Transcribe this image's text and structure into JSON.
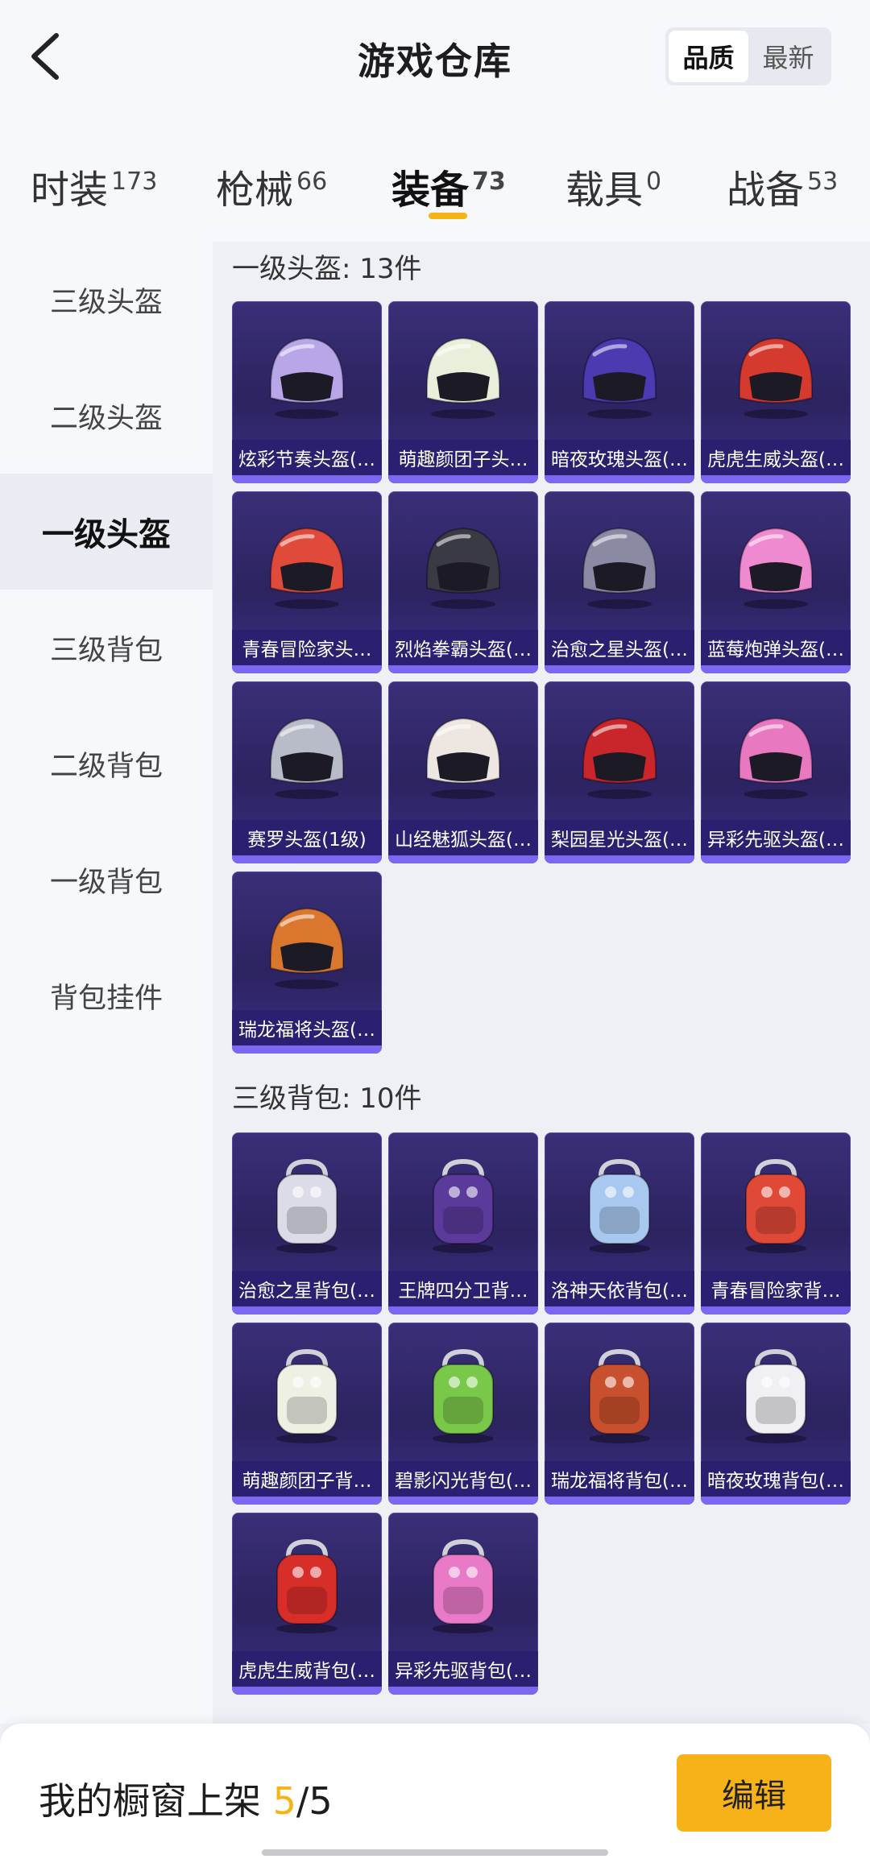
{
  "header": {
    "title": "游戏仓库",
    "sort_options": [
      "品质",
      "最新"
    ],
    "active_sort": "品质"
  },
  "tabs": [
    {
      "label": "时装",
      "count": "173"
    },
    {
      "label": "枪械",
      "count": "66"
    },
    {
      "label": "装备",
      "count": "73"
    },
    {
      "label": "载具",
      "count": "0"
    },
    {
      "label": "战备",
      "count": "53"
    }
  ],
  "active_tab": "装备",
  "sidebar": {
    "items": [
      "三级头盔",
      "二级头盔",
      "一级头盔",
      "三级背包",
      "二级背包",
      "一级背包",
      "背包挂件"
    ],
    "active": "一级头盔"
  },
  "sections": [
    {
      "title": "一级头盔: 13件",
      "items": [
        {
          "name": "炫彩节奏头盔(…",
          "icon": "helmet-icon",
          "color": "#b9a6e8"
        },
        {
          "name": "萌趣颜团子头…",
          "icon": "helmet-icon",
          "color": "#e8f0dc"
        },
        {
          "name": "暗夜玫瑰头盔(…",
          "icon": "helmet-icon",
          "color": "#4b3ab0"
        },
        {
          "name": "虎虎生威头盔(…",
          "icon": "helmet-icon",
          "color": "#d63a2e"
        },
        {
          "name": "青春冒险家头…",
          "icon": "helmet-icon",
          "color": "#e04a3a"
        },
        {
          "name": "烈焰拳霸头盔(…",
          "icon": "helmet-icon",
          "color": "#3a3a44"
        },
        {
          "name": "治愈之星头盔(…",
          "icon": "helmet-icon",
          "color": "#8a8aa4"
        },
        {
          "name": "蓝莓炮弹头盔(…",
          "icon": "helmet-icon",
          "color": "#f08ad0"
        },
        {
          "name": "赛罗头盔(1级)",
          "icon": "helmet-icon",
          "color": "#b8bcc8"
        },
        {
          "name": "山经魅狐头盔(…",
          "icon": "helmet-icon",
          "color": "#eee6e0"
        },
        {
          "name": "梨园星光头盔(…",
          "icon": "helmet-icon",
          "color": "#c8262a"
        },
        {
          "name": "异彩先驱头盔(…",
          "icon": "helmet-icon",
          "color": "#e878c0"
        },
        {
          "name": "瑞龙福将头盔(…",
          "icon": "helmet-icon",
          "color": "#d9772e"
        }
      ]
    },
    {
      "title": "三级背包: 10件",
      "items": [
        {
          "name": "治愈之星背包(…",
          "icon": "backpack-icon",
          "color": "#dcdce8"
        },
        {
          "name": "王牌四分卫背…",
          "icon": "backpack-icon",
          "color": "#5a3a9a"
        },
        {
          "name": "洛神天依背包(…",
          "icon": "backpack-icon",
          "color": "#a8c8f0"
        },
        {
          "name": "青春冒险家背…",
          "icon": "backpack-icon",
          "color": "#e04838"
        },
        {
          "name": "萌趣颜团子背…",
          "icon": "backpack-icon",
          "color": "#eef0e4"
        },
        {
          "name": "碧影闪光背包(…",
          "icon": "backpack-icon",
          "color": "#7ac84a"
        },
        {
          "name": "瑞龙福将背包(…",
          "icon": "backpack-icon",
          "color": "#c8502e"
        },
        {
          "name": "暗夜玫瑰背包(…",
          "icon": "backpack-icon",
          "color": "#f0f0f4"
        },
        {
          "name": "虎虎生威背包(…",
          "icon": "backpack-icon",
          "color": "#d82e2a"
        },
        {
          "name": "异彩先驱背包(…",
          "icon": "backpack-icon",
          "color": "#e87ac8"
        }
      ]
    }
  ],
  "footer": {
    "shelf_label": "我的橱窗上架",
    "shelf_current": "5",
    "shelf_total": "/5",
    "edit_label": "编辑"
  }
}
